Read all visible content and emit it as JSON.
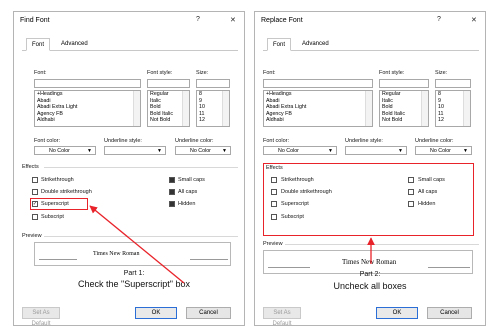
{
  "dialog1": {
    "title": "Find Font",
    "help": "?",
    "close": "✕",
    "tabs": [
      "Font",
      "Advanced"
    ],
    "font_label": "Font:",
    "style_label": "Font style:",
    "size_label": "Size:",
    "fonts": [
      "+Headings",
      "Abadi",
      "Abadi Extra Light",
      "Agency FB",
      "Aldhabi"
    ],
    "styles": [
      "Regular",
      "Italic",
      "Bold",
      "Bold Italic",
      "Not Bold"
    ],
    "sizes": [
      "8",
      "9",
      "10",
      "11",
      "12"
    ],
    "font_color_label": "Font color:",
    "font_color_value": "No Color",
    "underline_style_label": "Underline style:",
    "underline_color_label": "Underline color:",
    "underline_color_value": "No Color",
    "effects_label": "Effects",
    "effects_left": [
      {
        "label": "Strikethrough",
        "checked": false
      },
      {
        "label": "Double strikethrough",
        "checked": false
      },
      {
        "label": "Superscript",
        "checked": true
      },
      {
        "label": "Subscript",
        "checked": false
      }
    ],
    "effects_right": [
      {
        "label": "Small caps",
        "checked": true
      },
      {
        "label": "All caps",
        "checked": true
      },
      {
        "label": "Hidden",
        "checked": true
      }
    ],
    "preview_label": "Preview",
    "preview_text": "Times New Roman",
    "set_default": "Set As Default",
    "ok": "OK",
    "cancel": "Cancel",
    "caption_part": "Part 1:",
    "caption_text": "Check the \"Superscript\" box"
  },
  "dialog2": {
    "title": "Replace Font",
    "help": "?",
    "close": "✕",
    "tabs": [
      "Font",
      "Advanced"
    ],
    "font_label": "Font:",
    "style_label": "Font style:",
    "size_label": "Size:",
    "fonts": [
      "+Headings",
      "Abadi",
      "Abadi Extra Light",
      "Agency FB",
      "Aldhabi"
    ],
    "styles": [
      "Regular",
      "Italic",
      "Bold",
      "Bold Italic",
      "Not Bold"
    ],
    "sizes": [
      "8",
      "9",
      "10",
      "11",
      "12"
    ],
    "font_color_label": "Font color:",
    "font_color_value": "No Color",
    "underline_style_label": "Underline style:",
    "underline_color_label": "Underline color:",
    "underline_color_value": "No Color",
    "effects_label": "Effects",
    "effects_left": [
      {
        "label": "Strikethrough",
        "checked": false
      },
      {
        "label": "Double strikethrough",
        "checked": false
      },
      {
        "label": "Superscript",
        "checked": false
      },
      {
        "label": "Subscript",
        "checked": false
      }
    ],
    "effects_right": [
      {
        "label": "Small caps",
        "checked": false
      },
      {
        "label": "All caps",
        "checked": false
      },
      {
        "label": "Hidden",
        "checked": false
      }
    ],
    "preview_label": "Preview",
    "preview_text": "Times New Roman",
    "set_default": "Set As Default",
    "ok": "OK",
    "cancel": "Cancel",
    "caption_part": "Part 2:",
    "caption_text": "Uncheck all boxes"
  },
  "colors": {
    "annotation_red": "#e8232a",
    "ok_border": "#2b6fd6"
  }
}
